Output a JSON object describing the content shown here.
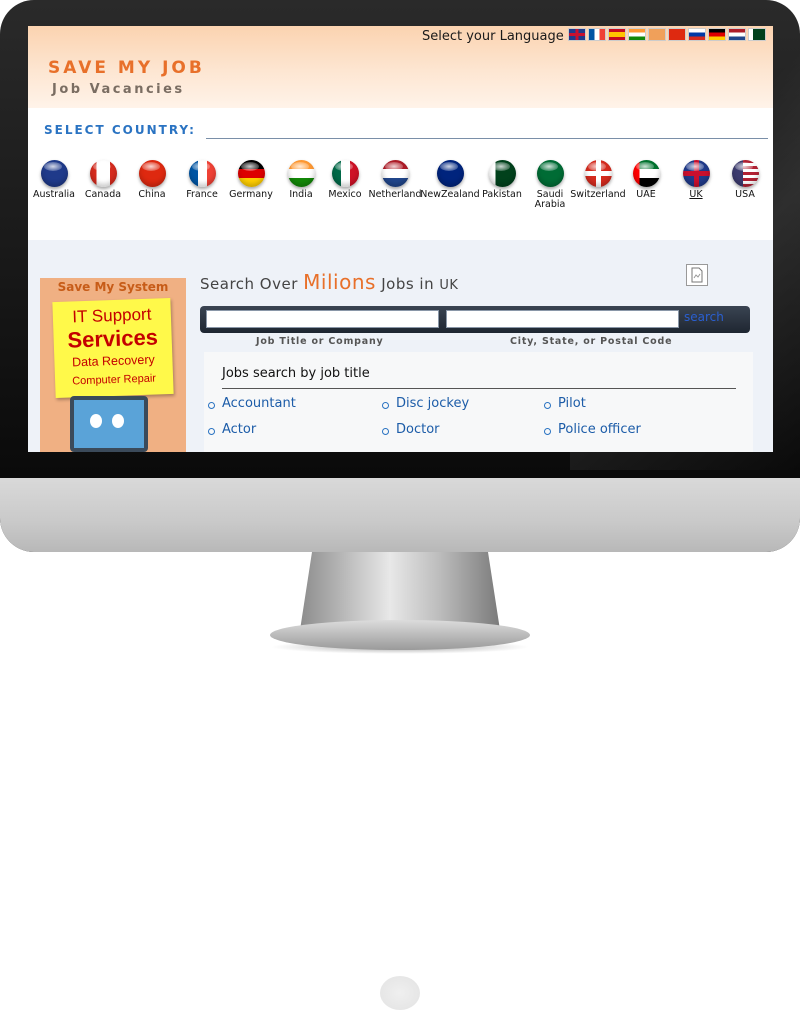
{
  "header": {
    "site_title": "SAVE MY JOB",
    "site_subtitle": "Job Vacancies",
    "language_label": "Select your Language",
    "language_flags": [
      "uk-flag-icon",
      "france-flag-icon",
      "spain-flag-icon",
      "india-flag-icon",
      "china-flag-icon",
      "china-flag-icon",
      "russia-flag-icon",
      "germany-flag-icon",
      "netherlands-flag-icon",
      "pakistan-flag-icon"
    ]
  },
  "country_select": {
    "label": "SELECT COUNTRY:",
    "countries": [
      {
        "name": "Australia"
      },
      {
        "name": "Canada"
      },
      {
        "name": "China"
      },
      {
        "name": "France"
      },
      {
        "name": "Germany"
      },
      {
        "name": "India"
      },
      {
        "name": "Mexico"
      },
      {
        "name": "Netherland"
      },
      {
        "name": "NewZealand"
      },
      {
        "name": "Pakistan"
      },
      {
        "name": "Saudi Arabia"
      },
      {
        "name": "Switzerland"
      },
      {
        "name": "UAE"
      },
      {
        "name": "UK"
      },
      {
        "name": "USA"
      }
    ],
    "selected": "UK"
  },
  "ad": {
    "top": "Save My System",
    "line1": "IT Support",
    "line2": "Services",
    "line3": "Data Recovery",
    "line4": "Computer Repair"
  },
  "search": {
    "heading_prefix": "Search Over",
    "heading_highlight": "Milions",
    "heading_mid": "Jobs in",
    "heading_country": "UK",
    "title_value": "",
    "location_value": "",
    "button_label": "search",
    "title_caption": "Job Title or Company",
    "location_caption": "City, State, or Postal Code"
  },
  "jobs": {
    "heading": "Jobs search by job title",
    "col1": [
      "Accountant",
      "Actor"
    ],
    "col2": [
      "Disc jockey",
      "Doctor"
    ],
    "col3": [
      "Pilot",
      "Police officer"
    ]
  },
  "colors": {
    "brand_orange": "#e8702a",
    "country_label_blue": "#2a73c2",
    "link_blue": "#1c5ca8"
  }
}
